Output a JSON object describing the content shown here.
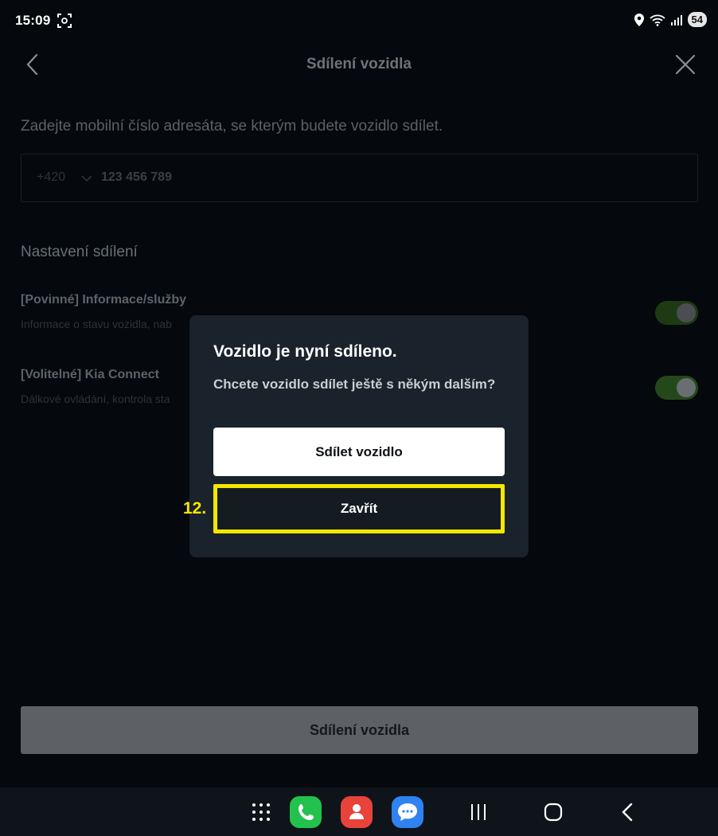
{
  "status_bar": {
    "time": "15:09",
    "battery": "54",
    "icons": [
      "screenshot-icon",
      "location-icon",
      "wifi-icon",
      "signal-icon",
      "battery-icon"
    ]
  },
  "header": {
    "title": "Sdílení vozidla",
    "back_icon": "chevron-left-icon",
    "close_icon": "close-icon"
  },
  "form": {
    "instruction": "Zadejte mobilní číslo adresáta, se kterým budete vozidlo sdílet.",
    "country_code": "+420",
    "phone_placeholder": "123 456 789"
  },
  "settings": {
    "section_title": "Nastavení sdílení",
    "items": [
      {
        "label": "[Povinné] Informace/služby",
        "description": "Informace o stavu vozidla, nab",
        "enabled": true
      },
      {
        "label": "[Volitelné] Kia Connect",
        "description": "Dálkové ovládání, kontrola sta",
        "enabled": true
      }
    ]
  },
  "bottom_button_label": "Sdílení vozidla",
  "modal": {
    "title": "Vozidlo je nyní sdíleno.",
    "message": "Chcete vozidlo sdílet ještě s někým dalším?",
    "share_button": "Sdílet vozidlo",
    "close_button": "Zavřít",
    "step_label": "12."
  },
  "nav_bar": {
    "apps": [
      "phone-app-icon",
      "contacts-app-icon",
      "messages-app-icon"
    ]
  },
  "colors": {
    "background": "#05080c",
    "modal_background": "#1a232b",
    "highlight": "#f5e600",
    "toggle_on": "#25481a"
  }
}
